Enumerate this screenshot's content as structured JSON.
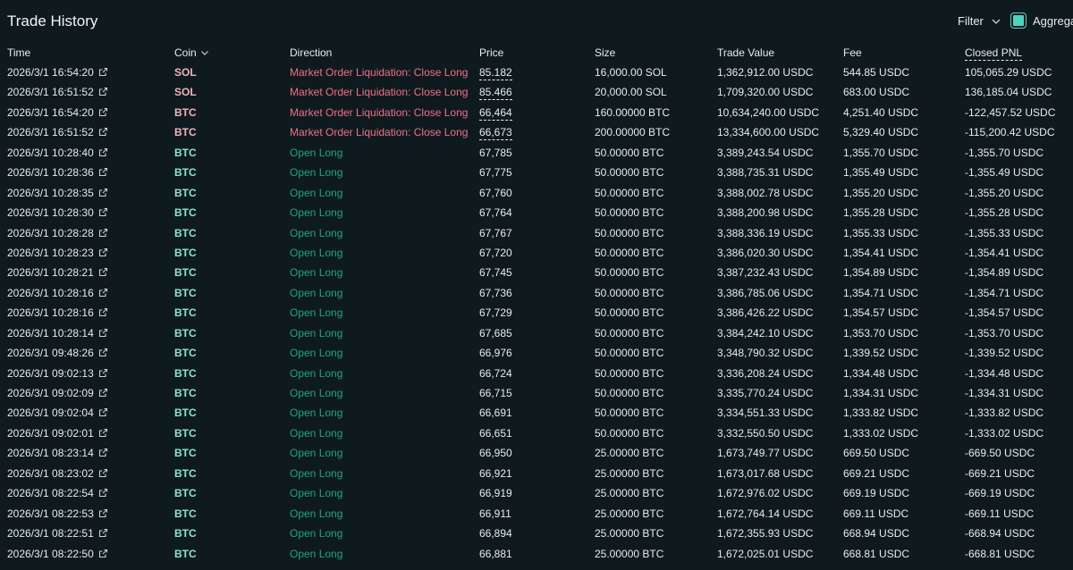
{
  "header": {
    "title": "Trade History",
    "filter_label": "Filter",
    "aggregate_label": "Aggregate"
  },
  "columns": {
    "time": "Time",
    "coin": "Coin",
    "direction": "Direction",
    "price": "Price",
    "size": "Size",
    "trade_value": "Trade Value",
    "fee": "Fee",
    "closed_pnl": "Closed PNL"
  },
  "colors": {
    "background": "#0f1a1f",
    "liquidation_red": "#ed7088",
    "long_green": "#1fa67d",
    "accent_teal": "#50d2c1"
  },
  "icons": {
    "external_link": "external-link-icon",
    "chevron": "chevron-down-icon"
  },
  "rows": [
    {
      "time": "2026/3/1 16:54:20",
      "coin": "SOL",
      "direction": "Market Order Liquidation: Close Long",
      "kind": "liq",
      "price": "85.182",
      "size": "16,000.00 SOL",
      "value": "1,362,912.00 USDC",
      "fee": "544.85 USDC",
      "pnl": "105,065.29 USDC"
    },
    {
      "time": "2026/3/1 16:51:52",
      "coin": "SOL",
      "direction": "Market Order Liquidation: Close Long",
      "kind": "liq",
      "price": "85.466",
      "size": "20,000.00 SOL",
      "value": "1,709,320.00 USDC",
      "fee": "683.00 USDC",
      "pnl": "136,185.04 USDC"
    },
    {
      "time": "2026/3/1 16:54:20",
      "coin": "BTC",
      "direction": "Market Order Liquidation: Close Long",
      "kind": "liq",
      "price": "66,464",
      "size": "160.00000 BTC",
      "value": "10,634,240.00 USDC",
      "fee": "4,251.40 USDC",
      "pnl": "-122,457.52 USDC"
    },
    {
      "time": "2026/3/1 16:51:52",
      "coin": "BTC",
      "direction": "Market Order Liquidation: Close Long",
      "kind": "liq",
      "price": "66,673",
      "size": "200.00000 BTC",
      "value": "13,334,600.00 USDC",
      "fee": "5,329.40 USDC",
      "pnl": "-115,200.42 USDC"
    },
    {
      "time": "2026/3/1 10:28:40",
      "coin": "BTC",
      "direction": "Open Long",
      "kind": "long",
      "price": "67,785",
      "size": "50.00000 BTC",
      "value": "3,389,243.54 USDC",
      "fee": "1,355.70 USDC",
      "pnl": "-1,355.70 USDC"
    },
    {
      "time": "2026/3/1 10:28:36",
      "coin": "BTC",
      "direction": "Open Long",
      "kind": "long",
      "price": "67,775",
      "size": "50.00000 BTC",
      "value": "3,388,735.31 USDC",
      "fee": "1,355.49 USDC",
      "pnl": "-1,355.49 USDC"
    },
    {
      "time": "2026/3/1 10:28:35",
      "coin": "BTC",
      "direction": "Open Long",
      "kind": "long",
      "price": "67,760",
      "size": "50.00000 BTC",
      "value": "3,388,002.78 USDC",
      "fee": "1,355.20 USDC",
      "pnl": "-1,355.20 USDC"
    },
    {
      "time": "2026/3/1 10:28:30",
      "coin": "BTC",
      "direction": "Open Long",
      "kind": "long",
      "price": "67,764",
      "size": "50.00000 BTC",
      "value": "3,388,200.98 USDC",
      "fee": "1,355.28 USDC",
      "pnl": "-1,355.28 USDC"
    },
    {
      "time": "2026/3/1 10:28:28",
      "coin": "BTC",
      "direction": "Open Long",
      "kind": "long",
      "price": "67,767",
      "size": "50.00000 BTC",
      "value": "3,388,336.19 USDC",
      "fee": "1,355.33 USDC",
      "pnl": "-1,355.33 USDC"
    },
    {
      "time": "2026/3/1 10:28:23",
      "coin": "BTC",
      "direction": "Open Long",
      "kind": "long",
      "price": "67,720",
      "size": "50.00000 BTC",
      "value": "3,386,020.30 USDC",
      "fee": "1,354.41 USDC",
      "pnl": "-1,354.41 USDC"
    },
    {
      "time": "2026/3/1 10:28:21",
      "coin": "BTC",
      "direction": "Open Long",
      "kind": "long",
      "price": "67,745",
      "size": "50.00000 BTC",
      "value": "3,387,232.43 USDC",
      "fee": "1,354.89 USDC",
      "pnl": "-1,354.89 USDC"
    },
    {
      "time": "2026/3/1 10:28:16",
      "coin": "BTC",
      "direction": "Open Long",
      "kind": "long",
      "price": "67,736",
      "size": "50.00000 BTC",
      "value": "3,386,785.06 USDC",
      "fee": "1,354.71 USDC",
      "pnl": "-1,354.71 USDC"
    },
    {
      "time": "2026/3/1 10:28:16",
      "coin": "BTC",
      "direction": "Open Long",
      "kind": "long",
      "price": "67,729",
      "size": "50.00000 BTC",
      "value": "3,386,426.22 USDC",
      "fee": "1,354.57 USDC",
      "pnl": "-1,354.57 USDC"
    },
    {
      "time": "2026/3/1 10:28:14",
      "coin": "BTC",
      "direction": "Open Long",
      "kind": "long",
      "price": "67,685",
      "size": "50.00000 BTC",
      "value": "3,384,242.10 USDC",
      "fee": "1,353.70 USDC",
      "pnl": "-1,353.70 USDC"
    },
    {
      "time": "2026/3/1 09:48:26",
      "coin": "BTC",
      "direction": "Open Long",
      "kind": "long",
      "price": "66,976",
      "size": "50.00000 BTC",
      "value": "3,348,790.32 USDC",
      "fee": "1,339.52 USDC",
      "pnl": "-1,339.52 USDC"
    },
    {
      "time": "2026/3/1 09:02:13",
      "coin": "BTC",
      "direction": "Open Long",
      "kind": "long",
      "price": "66,724",
      "size": "50.00000 BTC",
      "value": "3,336,208.24 USDC",
      "fee": "1,334.48 USDC",
      "pnl": "-1,334.48 USDC"
    },
    {
      "time": "2026/3/1 09:02:09",
      "coin": "BTC",
      "direction": "Open Long",
      "kind": "long",
      "price": "66,715",
      "size": "50.00000 BTC",
      "value": "3,335,770.24 USDC",
      "fee": "1,334.31 USDC",
      "pnl": "-1,334.31 USDC"
    },
    {
      "time": "2026/3/1 09:02:04",
      "coin": "BTC",
      "direction": "Open Long",
      "kind": "long",
      "price": "66,691",
      "size": "50.00000 BTC",
      "value": "3,334,551.33 USDC",
      "fee": "1,333.82 USDC",
      "pnl": "-1,333.82 USDC"
    },
    {
      "time": "2026/3/1 09:02:01",
      "coin": "BTC",
      "direction": "Open Long",
      "kind": "long",
      "price": "66,651",
      "size": "50.00000 BTC",
      "value": "3,332,550.50 USDC",
      "fee": "1,333.02 USDC",
      "pnl": "-1,333.02 USDC"
    },
    {
      "time": "2026/3/1 08:23:14",
      "coin": "BTC",
      "direction": "Open Long",
      "kind": "long",
      "price": "66,950",
      "size": "25.00000 BTC",
      "value": "1,673,749.77 USDC",
      "fee": "669.50 USDC",
      "pnl": "-669.50 USDC"
    },
    {
      "time": "2026/3/1 08:23:02",
      "coin": "BTC",
      "direction": "Open Long",
      "kind": "long",
      "price": "66,921",
      "size": "25.00000 BTC",
      "value": "1,673,017.68 USDC",
      "fee": "669.21 USDC",
      "pnl": "-669.21 USDC"
    },
    {
      "time": "2026/3/1 08:22:54",
      "coin": "BTC",
      "direction": "Open Long",
      "kind": "long",
      "price": "66,919",
      "size": "25.00000 BTC",
      "value": "1,672,976.02 USDC",
      "fee": "669.19 USDC",
      "pnl": "-669.19 USDC"
    },
    {
      "time": "2026/3/1 08:22:53",
      "coin": "BTC",
      "direction": "Open Long",
      "kind": "long",
      "price": "66,911",
      "size": "25.00000 BTC",
      "value": "1,672,764.14 USDC",
      "fee": "669.11 USDC",
      "pnl": "-669.11 USDC"
    },
    {
      "time": "2026/3/1 08:22:51",
      "coin": "BTC",
      "direction": "Open Long",
      "kind": "long",
      "price": "66,894",
      "size": "25.00000 BTC",
      "value": "1,672,355.93 USDC",
      "fee": "668.94 USDC",
      "pnl": "-668.94 USDC"
    },
    {
      "time": "2026/3/1 08:22:50",
      "coin": "BTC",
      "direction": "Open Long",
      "kind": "long",
      "price": "66,881",
      "size": "25.00000 BTC",
      "value": "1,672,025.01 USDC",
      "fee": "668.81 USDC",
      "pnl": "-668.81 USDC"
    }
  ]
}
